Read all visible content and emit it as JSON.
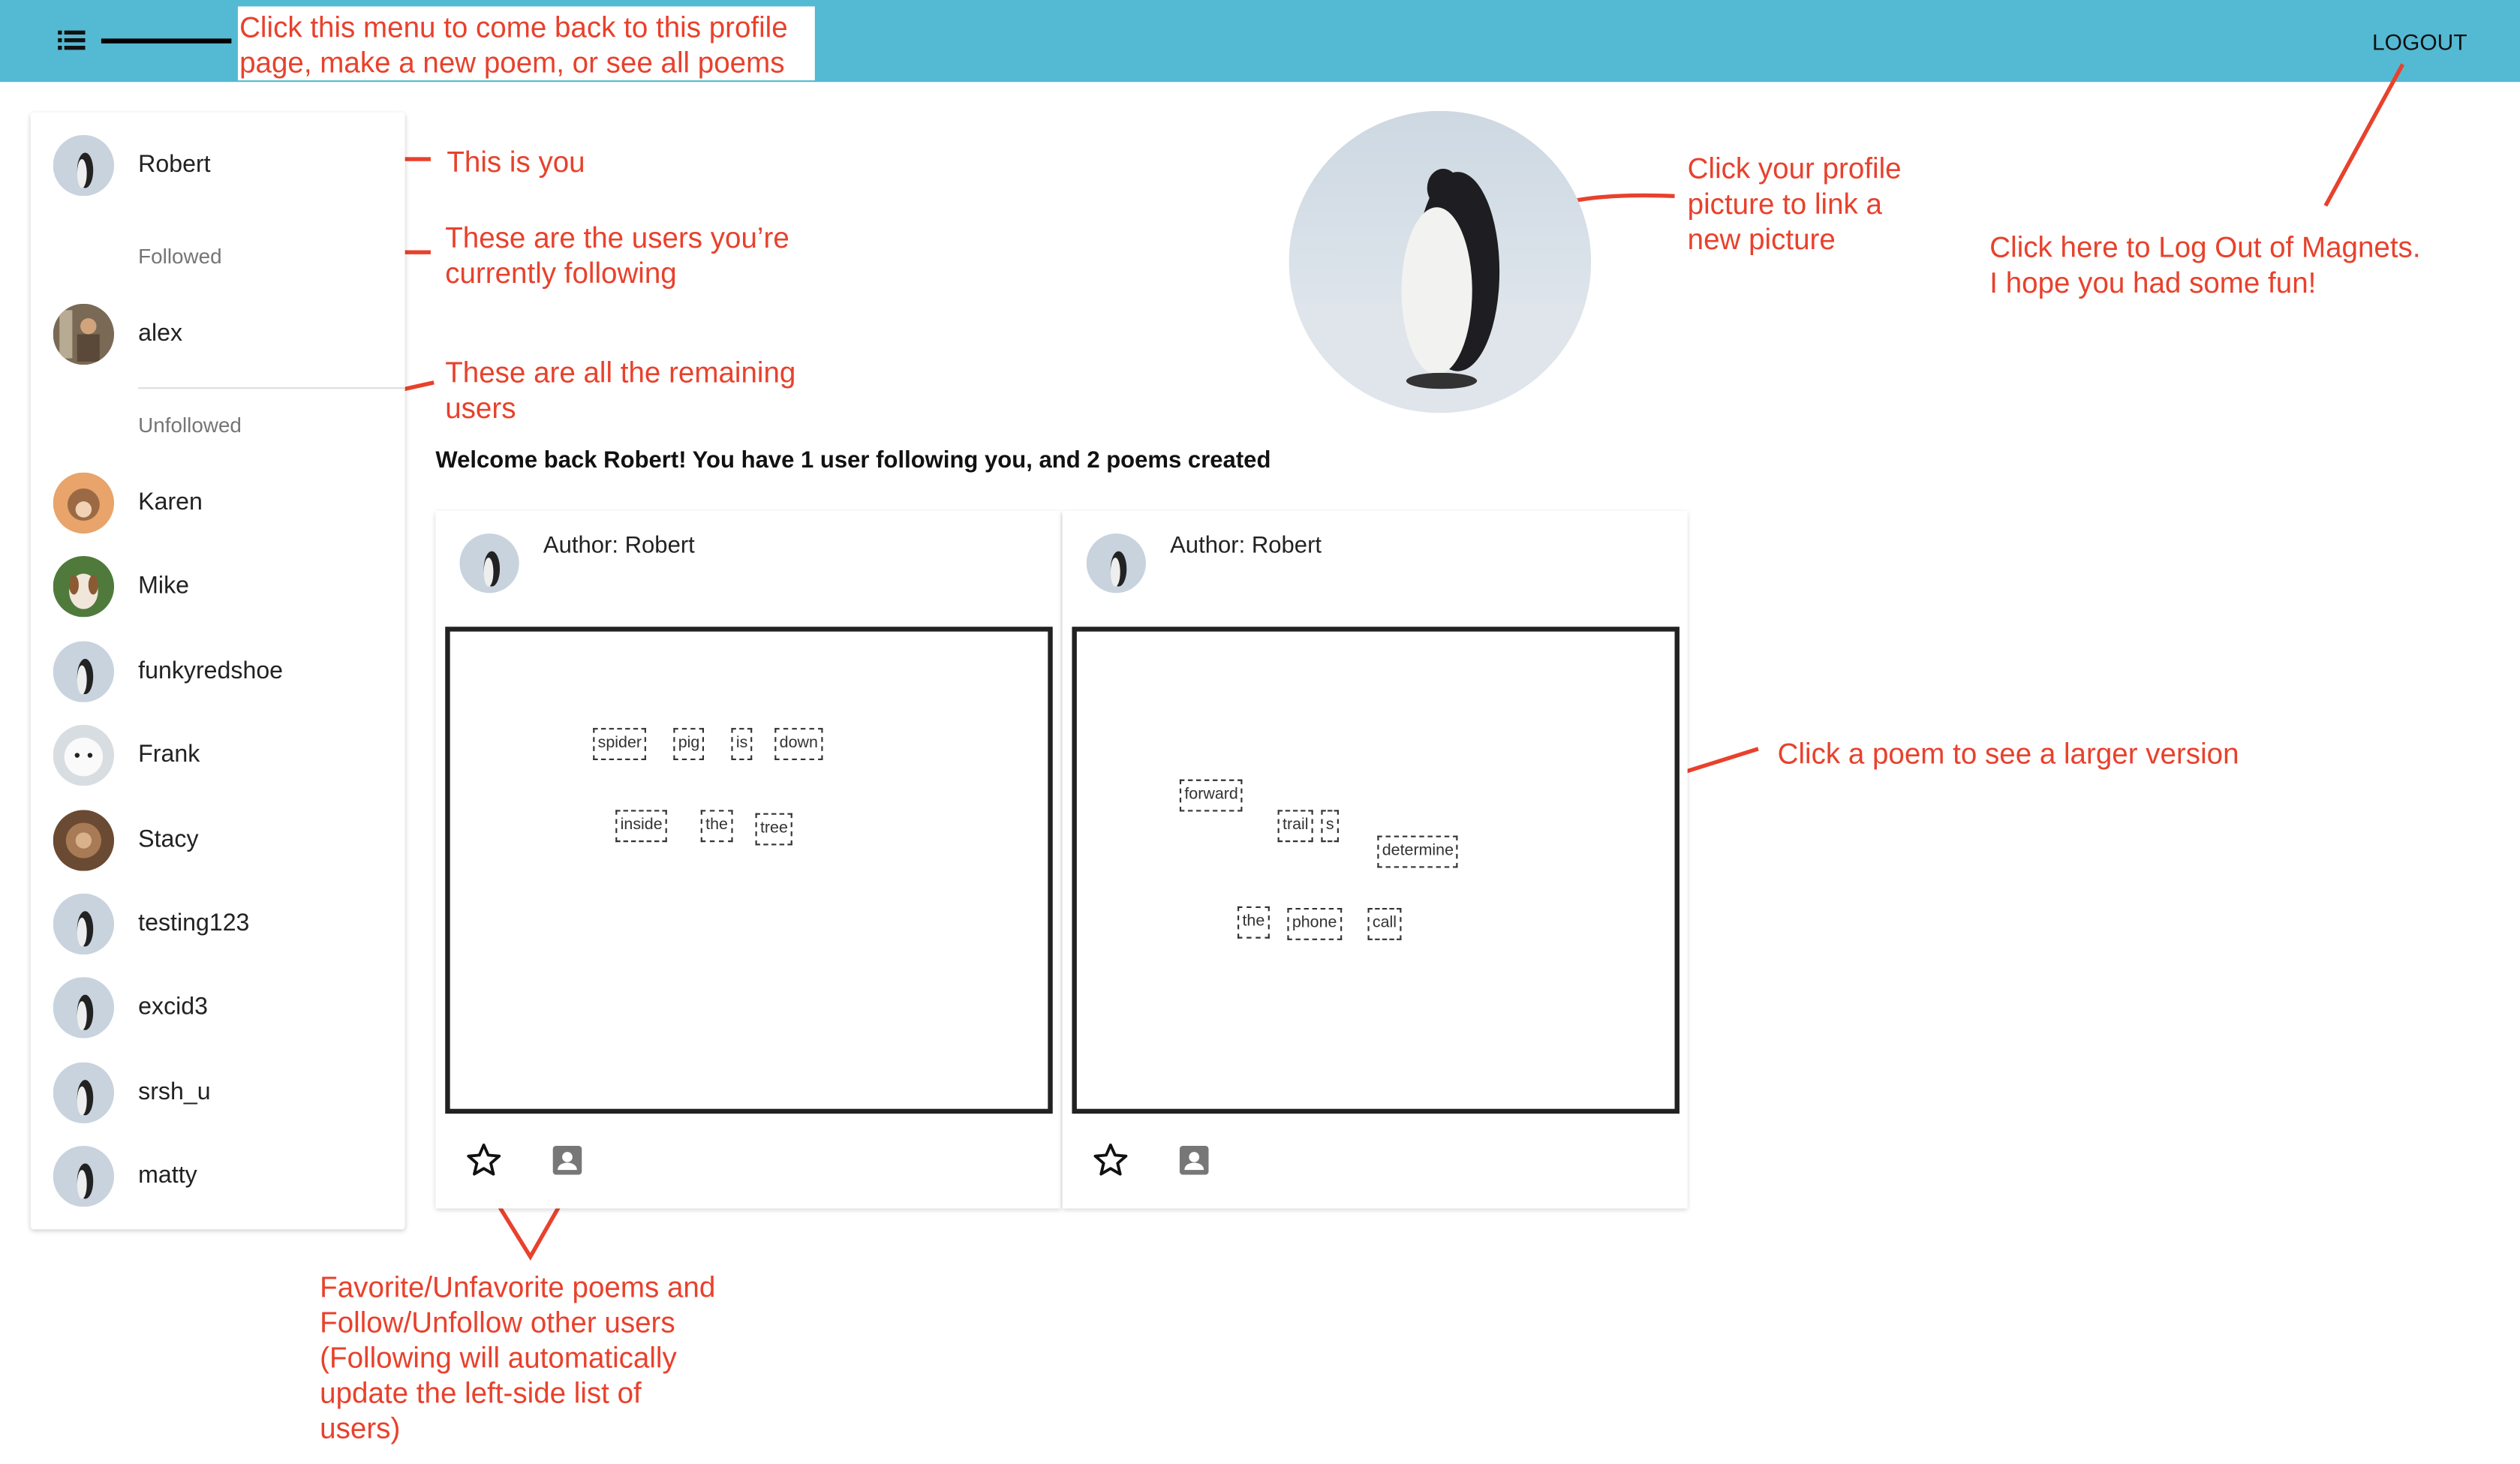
{
  "topbar": {
    "menu_icon": "list-menu-icon",
    "logout_label": "LOGOUT",
    "color": "#54b9d3"
  },
  "sidebar": {
    "current_user": {
      "name": "Robert",
      "avatar": "penguin"
    },
    "followed_label": "Followed",
    "followed": [
      {
        "name": "alex",
        "avatar": "photo"
      }
    ],
    "unfollowed_label": "Unfollowed",
    "unfollowed": [
      {
        "name": "Karen",
        "avatar": "dog"
      },
      {
        "name": "Mike",
        "avatar": "puppy"
      },
      {
        "name": "funkyredshoe",
        "avatar": "penguin"
      },
      {
        "name": "Frank",
        "avatar": "white-dog"
      },
      {
        "name": "Stacy",
        "avatar": "brown"
      },
      {
        "name": "testing123",
        "avatar": "penguin"
      },
      {
        "name": "excid3",
        "avatar": "penguin"
      },
      {
        "name": "srsh_u",
        "avatar": "penguin"
      },
      {
        "name": "matty",
        "avatar": "penguin"
      }
    ]
  },
  "main": {
    "welcome": "Welcome back Robert! You have 1 user following you, and 2 poems created",
    "poems": [
      {
        "author": "Author: Robert",
        "words": [
          "spider",
          "pig",
          "is",
          "down",
          "inside",
          "the",
          "tree"
        ]
      },
      {
        "author": "Author: Robert",
        "words": [
          "forward",
          "trail",
          "s",
          "determine",
          "the",
          "phone",
          "call"
        ]
      }
    ]
  },
  "annotations": {
    "menu": [
      "Click this menu to come back to this profile",
      "page, make a new poem, or see all poems"
    ],
    "you": [
      "This is you"
    ],
    "followed": [
      "These are the users you’re",
      "currently following"
    ],
    "remaining": [
      "These are all the remaining",
      "users"
    ],
    "profile_pic": [
      "Click your profile",
      "picture to link a",
      "new picture"
    ],
    "logout": [
      "Click here to Log Out of Magnets.",
      "I hope you had some fun!"
    ],
    "poem": [
      "Click a poem to see a larger version"
    ],
    "actions": [
      "Favorite/Unfavorite poems and",
      "Follow/Unfollow other users",
      "(Following will automatically",
      "update the left-side list of",
      "users)"
    ],
    "color": "#e8412c"
  }
}
